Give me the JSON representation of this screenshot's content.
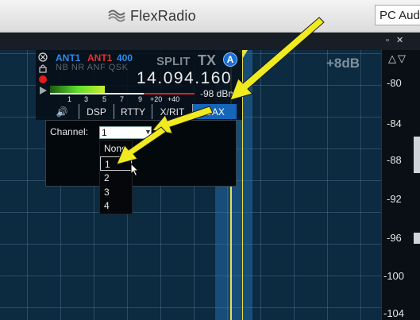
{
  "app": {
    "brand": "FlexRadio",
    "audio_device": "PC Aud"
  },
  "window_controls": "▫ ✕",
  "panadapter": {
    "gain_label": "+8dB",
    "scale_arrows": "△▽",
    "scale_ticks": [
      "-80",
      "-84",
      "-88",
      "-92",
      "-96",
      "-100",
      "-104"
    ]
  },
  "slice": {
    "antenna_rx": "ANT1",
    "antenna_tx": "ANT1",
    "filter_width": "400",
    "flags": "NB NR ANF QSK",
    "split_label": "SPLIT",
    "tx_label": "TX",
    "slice_letter": "A",
    "frequency": "14.094.160",
    "signal_level": "-98 dBm",
    "meter_ticks": [
      "1",
      "3",
      "5",
      "7",
      "9",
      "+20",
      "+40"
    ],
    "meter_level": 0.38,
    "tabs": [
      {
        "label": "🔊",
        "active": false
      },
      {
        "label": "DSP",
        "active": false
      },
      {
        "label": "RTTY",
        "active": false
      },
      {
        "label": "X/RIT",
        "active": false
      },
      {
        "label": "DAX",
        "active": true
      }
    ]
  },
  "dax": {
    "channel_label": "Channel:",
    "channel_value": "1",
    "options": [
      "None",
      "1",
      "2",
      "3",
      "4"
    ],
    "selected_option": "1"
  },
  "colors": {
    "accent_blue": "#1565b8",
    "ant_blue": "#2a8cf0",
    "ant_red": "#e53030",
    "annotation_arrow": "#f0ea20"
  }
}
